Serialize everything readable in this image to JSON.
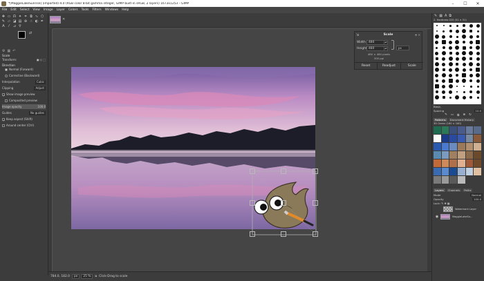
{
  "window": {
    "title": "*[MaggieLakeSunrise] (imported)-4.0 (RGB color 8-bit gamma integer, GIMP built-in sRGB, 2 layers) 1673x1253 – GIMP",
    "minimize": "–",
    "maximize": "☐",
    "close": "✕"
  },
  "menu": [
    "File",
    "Edit",
    "Select",
    "View",
    "Image",
    "Layer",
    "Colors",
    "Tools",
    "Filters",
    "Windows",
    "Help"
  ],
  "toolbox": {
    "tab_label": "Scale",
    "transform_label": "Transform:",
    "direction_label": "Direction",
    "direction_normal": "Normal (Forward)",
    "direction_corrective": "Corrective (Backward)",
    "interpolation_label": "Interpolation",
    "interpolation_value": "Cubic",
    "clipping_label": "Clipping",
    "clipping_value": "Adjust",
    "show_preview": "Show image preview",
    "composited_preview": "Composited preview",
    "image_opacity_label": "Image opacity",
    "image_opacity_value": "100.0",
    "guides_label": "Guides",
    "guides_value": "No guides",
    "keep_aspect": "Keep aspect (Shift)",
    "around_center": "Around center (Ctrl)"
  },
  "scale_dialog": {
    "title": "Scale",
    "width_label": "Width",
    "width_value": "480",
    "height_label": "Height",
    "height_value": "480",
    "unit": "px",
    "size_info": "480 × 480 pixels",
    "resolution_info": "300 ppi",
    "reset": "Reset",
    "readjust": "Readjust",
    "scale": "Scale"
  },
  "status": {
    "coords": "784.0, 182.0",
    "unit": "px",
    "zoom": "25 %",
    "message": "Click-Drag to scale"
  },
  "dock": {
    "brush_title": "2. Hardness 025 (51 × 51)",
    "brush_category": "Basic,",
    "spacing_label": "Spacing",
    "spacing_value": "10.0",
    "tab_patterns": "Patterns",
    "tab_document_history": "Document History",
    "pattern_title": "3D Green (160 × 160)",
    "tab_layers": "Layers",
    "tab_channels": "Channels",
    "tab_paths": "Paths",
    "mode_label": "Mode",
    "mode_value": "Normal",
    "opacity_label": "Opacity",
    "opacity_value": "100.0",
    "lock_label": "Lock:",
    "layers": [
      {
        "name": "Watermark Layer"
      },
      {
        "name": "MaggieLakeSu..."
      }
    ]
  },
  "icons": {
    "tools": [
      "move-icon",
      "rect-select-icon",
      "lasso-icon",
      "fuzzy-select-icon",
      "crop-icon",
      "unified-transform-icon",
      "warp-icon",
      "cage-icon",
      "paintbrush-icon",
      "eraser-icon",
      "bucket-fill-icon",
      "gradient-icon"
    ]
  }
}
